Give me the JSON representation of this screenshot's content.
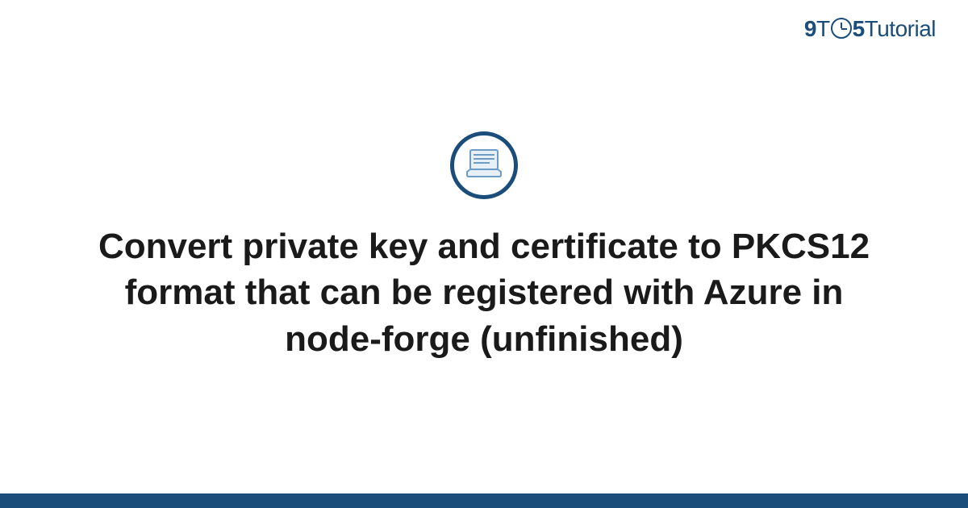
{
  "logo": {
    "nine": "9",
    "to": "T",
    "five": "5",
    "tutorial": "Tutorial"
  },
  "main": {
    "title": "Convert private key and certificate to PKCS12 format that can be registered with Azure in node-forge (unfinished)"
  },
  "colors": {
    "brand": "#1a4d7a",
    "text": "#1a1a1a",
    "icon_stroke": "#6d9cc7"
  }
}
